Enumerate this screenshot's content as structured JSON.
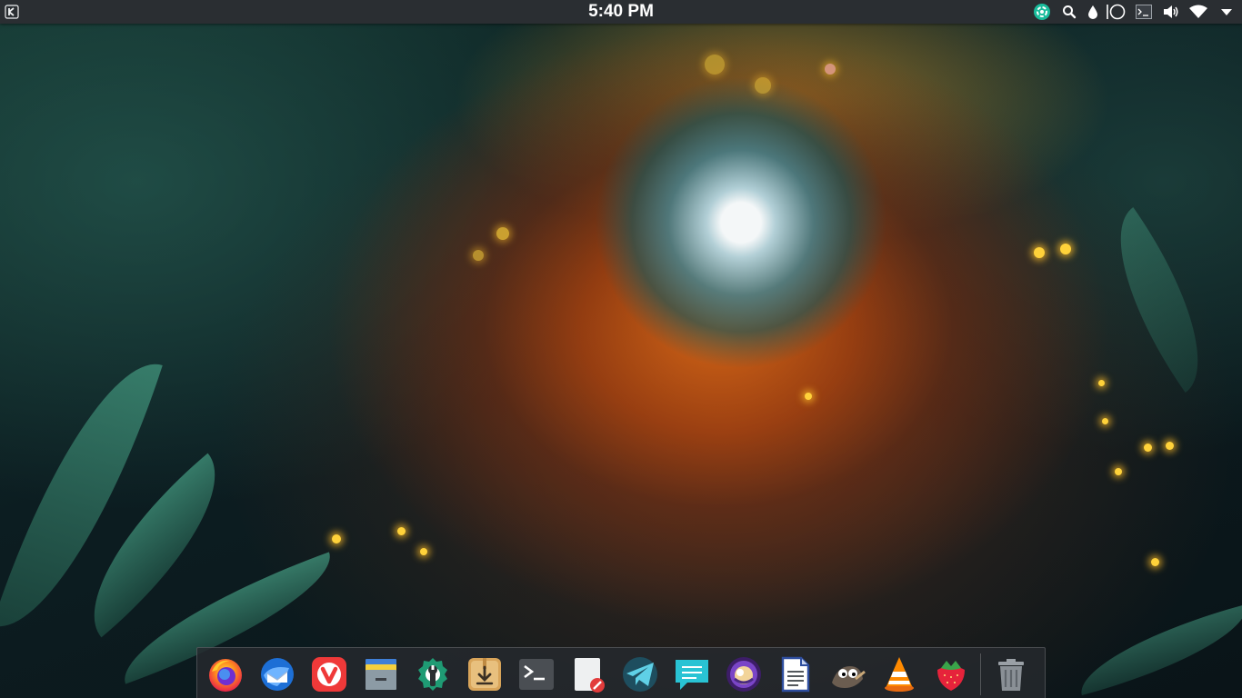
{
  "top_panel": {
    "launcher_icon": "kde-logo-icon",
    "clock": "5:40 PM",
    "tray": [
      {
        "name": "system-monitor-icon",
        "color": "#1abc9c"
      },
      {
        "name": "search-icon"
      },
      {
        "name": "color-picker-icon"
      },
      {
        "name": "night-color-icon"
      },
      {
        "name": "terminal-tray-icon"
      },
      {
        "name": "volume-icon"
      },
      {
        "name": "wifi-icon"
      },
      {
        "name": "panel-menu-icon"
      }
    ]
  },
  "dock": {
    "apps": [
      {
        "name": "firefox",
        "icon": "firefox-icon"
      },
      {
        "name": "thunderbird",
        "icon": "thunderbird-icon"
      },
      {
        "name": "vivaldi",
        "icon": "vivaldi-icon"
      },
      {
        "name": "file-manager",
        "icon": "file-manager-icon"
      },
      {
        "name": "system-settings",
        "icon": "settings-wrench-icon"
      },
      {
        "name": "software-installer",
        "icon": "package-download-icon"
      },
      {
        "name": "terminal",
        "icon": "terminal-icon"
      },
      {
        "name": "text-editor",
        "icon": "text-editor-icon"
      },
      {
        "name": "telegram",
        "icon": "telegram-icon"
      },
      {
        "name": "messaging",
        "icon": "chat-icon"
      },
      {
        "name": "sound-app",
        "icon": "purple-circle-app-icon"
      },
      {
        "name": "document-viewer",
        "icon": "document-icon"
      },
      {
        "name": "gimp",
        "icon": "gimp-icon"
      },
      {
        "name": "vlc",
        "icon": "vlc-icon"
      },
      {
        "name": "strawberry",
        "icon": "strawberry-icon"
      },
      {
        "name": "trash",
        "icon": "trash-icon"
      }
    ]
  },
  "colors": {
    "panel_bg": "#2a2e32",
    "dock_bg": "rgba(38,42,46,0.82)",
    "accent_teal": "#1abc9c"
  }
}
